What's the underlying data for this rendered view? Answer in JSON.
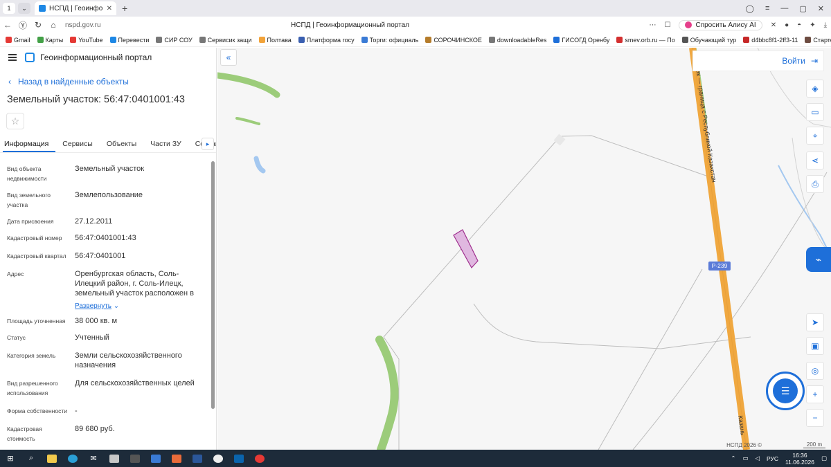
{
  "browser": {
    "tab_num": "1",
    "tab_title": "НСПД | Геоинформаци",
    "url": "nspd.gov.ru",
    "page_title": "НСПД | Геоинформационный портал",
    "alice": "Спросить Алису AI",
    "bookmarks": [
      "Gmail",
      "Карты",
      "YouTube",
      "Перевести",
      "СИР СОУ",
      "Сервисик защи",
      "Полтава",
      "Платформа госу",
      "Торги: официаль",
      "СОРОЧИНСКОЕ",
      "downloadableRes",
      "ГИСОГД Оренбу",
      "smev.orb.ru — По",
      "Обучающий тур",
      "d4bbc8f1-2ff3-11",
      "Стартовая стран"
    ]
  },
  "app": {
    "title": "Геоинформационный портал",
    "back_label": "Назад в найденные объекты",
    "object_title": "Земельный участок: 56:47:0401001:43",
    "tabs": [
      "Информация",
      "Сервисы",
      "Объекты",
      "Части ЗУ",
      "Состав"
    ],
    "expand_label": "Развернуть",
    "fields": [
      {
        "k": "Вид объекта недвижимости",
        "v": "Земельный участок"
      },
      {
        "k": "Вид земельного участка",
        "v": "Землепользование"
      },
      {
        "k": "Дата присвоения",
        "v": "27.12.2011"
      },
      {
        "k": "Кадастровый номер",
        "v": "56:47:0401001:43"
      },
      {
        "k": "Кадастровый квартал",
        "v": "56:47:0401001"
      },
      {
        "k": "Адрес",
        "v": "Оренбургская область, Соль-Илецкий район, г. Соль-Илецк, земельный участок расположен в"
      },
      {
        "k": "Площадь уточненная",
        "v": "38 000 кв. м"
      },
      {
        "k": "Статус",
        "v": "Учтенный"
      },
      {
        "k": "Категория земель",
        "v": "Земли сельскохозяйственного назначения"
      },
      {
        "k": "Вид разрешенного использования",
        "v": "Для сельскохозяйственных целей"
      },
      {
        "k": "Форма собственности",
        "v": "-"
      },
      {
        "k": "Кадастровая стоимость",
        "v": "89 680 руб."
      }
    ]
  },
  "map": {
    "login": "Войти",
    "road_label": "Р-239",
    "road_name_1": "Акбулак — граница с Республикой Казахстан",
    "road_name_2": "Казань",
    "copyright": "НСПД 2026 ©",
    "scale": "200 m"
  },
  "taskbar": {
    "lang": "РУС",
    "time": "16:36",
    "date": "11.06.2026"
  },
  "colors": {
    "accent": "#1e6fd9",
    "road": "#f0a840",
    "forest": "#9ccc7a",
    "parcel": "#a0308f"
  }
}
